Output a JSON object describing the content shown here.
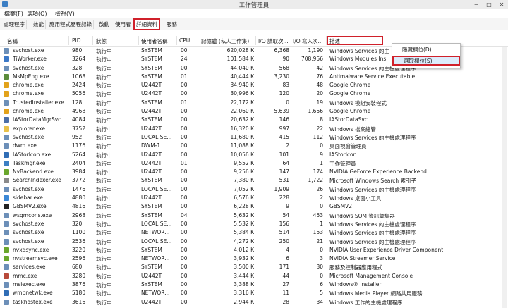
{
  "window": {
    "title": "工作管理員",
    "minimize": "─",
    "maximize": "□",
    "close": "✕"
  },
  "menubar": [
    "檔案(F)",
    "選項(O)",
    "檢視(V)"
  ],
  "tabs": [
    "處理程序",
    "效能",
    "應用程式歷程記錄",
    "啟動",
    "使用者",
    "詳細資料",
    "服務"
  ],
  "active_tab": 5,
  "columns": {
    "name": "名稱",
    "pid": "PID",
    "status": "狀態",
    "user": "使用者名稱",
    "cpu": "CPU",
    "memory": "記憶體 (私人工作集)",
    "io_read": "I/O 讀取次...",
    "io_write": "I/O 寫入次...",
    "desc": "描述"
  },
  "context_menu": {
    "items": [
      "隱藏欄位(D)",
      "選取欄位(S)"
    ],
    "selected": 1
  },
  "rows": [
    {
      "name": "svchost.exe",
      "pid": "980",
      "status": "執行中",
      "user": "SYSTEM",
      "cpu": "00",
      "mem": "620,028 K",
      "ior": "6,368",
      "iow": "1,190",
      "desc": "Windows Services 的主",
      "icon": "#6c8fb8"
    },
    {
      "name": "TiWorker.exe",
      "pid": "3264",
      "status": "執行中",
      "user": "SYSTEM",
      "cpu": "24",
      "mem": "101,584 K",
      "ior": "90",
      "iow": "708,956",
      "desc": "Windows Modules Ins",
      "icon": "#3b78c7"
    },
    {
      "name": "svchost.exe",
      "pid": "328",
      "status": "執行中",
      "user": "SYSTEM",
      "cpu": "00",
      "mem": "44,040 K",
      "ior": "568",
      "iow": "42",
      "desc": "Windows Services 的主機處理程序",
      "icon": "#6c8fb8"
    },
    {
      "name": "MsMpEng.exe",
      "pid": "1068",
      "status": "執行中",
      "user": "SYSTEM",
      "cpu": "01",
      "mem": "40,444 K",
      "ior": "3,230",
      "iow": "76",
      "desc": "Antimalware Service Executable",
      "icon": "#5b8c3a"
    },
    {
      "name": "chrome.exe",
      "pid": "2424",
      "status": "執行中",
      "user": "U2442T",
      "cpu": "00",
      "mem": "34,940 K",
      "ior": "83",
      "iow": "48",
      "desc": "Google Chrome",
      "icon": "#e2a21b"
    },
    {
      "name": "chrome.exe",
      "pid": "5056",
      "status": "執行中",
      "user": "U2442T",
      "cpu": "00",
      "mem": "30,996 K",
      "ior": "120",
      "iow": "20",
      "desc": "Google Chrome",
      "icon": "#e2a21b"
    },
    {
      "name": "TrustedInstaller.exe",
      "pid": "128",
      "status": "執行中",
      "user": "SYSTEM",
      "cpu": "01",
      "mem": "22,172 K",
      "ior": "0",
      "iow": "19",
      "desc": "Windows 模組安裝程式",
      "icon": "#6c8fb8"
    },
    {
      "name": "chrome.exe",
      "pid": "4968",
      "status": "執行中",
      "user": "U2442T",
      "cpu": "00",
      "mem": "22,060 K",
      "ior": "5,639",
      "iow": "1,656",
      "desc": "Google Chrome",
      "icon": "#e2a21b"
    },
    {
      "name": "IAStorDataMgrSvc....",
      "pid": "4084",
      "status": "執行中",
      "user": "SYSTEM",
      "cpu": "00",
      "mem": "20,632 K",
      "ior": "146",
      "iow": "8",
      "desc": "IAStorDataSvc",
      "icon": "#4a6ea8"
    },
    {
      "name": "explorer.exe",
      "pid": "3752",
      "status": "執行中",
      "user": "U2442T",
      "cpu": "00",
      "mem": "16,320 K",
      "ior": "997",
      "iow": "22",
      "desc": "Windows 檔案總管",
      "icon": "#e8c14a"
    },
    {
      "name": "svchost.exe",
      "pid": "952",
      "status": "執行中",
      "user": "LOCAL SE...",
      "cpu": "00",
      "mem": "11,680 K",
      "ior": "415",
      "iow": "112",
      "desc": "Windows Services 的主機處理程序",
      "icon": "#6c8fb8"
    },
    {
      "name": "dwm.exe",
      "pid": "1176",
      "status": "執行中",
      "user": "DWM-1",
      "cpu": "00",
      "mem": "11,088 K",
      "ior": "2",
      "iow": "0",
      "desc": "桌面視窗管理員",
      "icon": "#6c8fb8"
    },
    {
      "name": "IAStorIcon.exe",
      "pid": "5264",
      "status": "執行中",
      "user": "U2442T",
      "cpu": "00",
      "mem": "10,056 K",
      "ior": "101",
      "iow": "9",
      "desc": "IAStorIcon",
      "icon": "#2f6db5"
    },
    {
      "name": "Taskmgr.exe",
      "pid": "2404",
      "status": "執行中",
      "user": "U2442T",
      "cpu": "01",
      "mem": "9,552 K",
      "ior": "64",
      "iow": "1",
      "desc": "工作管理員",
      "icon": "#3c7fc4"
    },
    {
      "name": "NvBackend.exe",
      "pid": "3984",
      "status": "執行中",
      "user": "U2442T",
      "cpu": "00",
      "mem": "9,256 K",
      "ior": "147",
      "iow": "174",
      "desc": "NVIDIA GeForce Experience Backend",
      "icon": "#6aa72c"
    },
    {
      "name": "SearchIndexer.exe",
      "pid": "3772",
      "status": "執行中",
      "user": "SYSTEM",
      "cpu": "00",
      "mem": "7,380 K",
      "ior": "531",
      "iow": "1,722",
      "desc": "Microsoft Windows Search 索引子",
      "icon": "#8a8a8a"
    },
    {
      "name": "svchost.exe",
      "pid": "1476",
      "status": "執行中",
      "user": "LOCAL SE...",
      "cpu": "00",
      "mem": "7,052 K",
      "ior": "1,909",
      "iow": "26",
      "desc": "Windows Services 的主機處理程序",
      "icon": "#6c8fb8"
    },
    {
      "name": "sidebar.exe",
      "pid": "4880",
      "status": "執行中",
      "user": "U2442T",
      "cpu": "00",
      "mem": "6,576 K",
      "ior": "228",
      "iow": "2",
      "desc": "Windows 桌面小工具",
      "icon": "#3a87d6"
    },
    {
      "name": "GBSMV2.exe",
      "pid": "4816",
      "status": "執行中",
      "user": "SYSTEM",
      "cpu": "00",
      "mem": "6,228 K",
      "ior": "9",
      "iow": "0",
      "desc": "GBSMV2",
      "icon": "#222222"
    },
    {
      "name": "wsqmcons.exe",
      "pid": "2968",
      "status": "執行中",
      "user": "SYSTEM",
      "cpu": "04",
      "mem": "5,632 K",
      "ior": "54",
      "iow": "453",
      "desc": "Windows SQM 資訊彙集器",
      "icon": "#6c8fb8"
    },
    {
      "name": "svchost.exe",
      "pid": "320",
      "status": "執行中",
      "user": "LOCAL SE...",
      "cpu": "00",
      "mem": "5,532 K",
      "ior": "156",
      "iow": "1",
      "desc": "Windows Services 的主機處理程序",
      "icon": "#6c8fb8"
    },
    {
      "name": "svchost.exe",
      "pid": "1100",
      "status": "執行中",
      "user": "NETWOR...",
      "cpu": "00",
      "mem": "5,384 K",
      "ior": "514",
      "iow": "153",
      "desc": "Windows Services 的主機處理程序",
      "icon": "#6c8fb8"
    },
    {
      "name": "svchost.exe",
      "pid": "2536",
      "status": "執行中",
      "user": "LOCAL SE...",
      "cpu": "00",
      "mem": "4,272 K",
      "ior": "250",
      "iow": "21",
      "desc": "Windows Services 的主機處理程序",
      "icon": "#6c8fb8"
    },
    {
      "name": "nvxdsync.exe",
      "pid": "3220",
      "status": "執行中",
      "user": "SYSTEM",
      "cpu": "00",
      "mem": "4,012 K",
      "ior": "4",
      "iow": "0",
      "desc": "NVIDIA User Experience Driver Component",
      "icon": "#6aa72c"
    },
    {
      "name": "nvstreamsvc.exe",
      "pid": "2596",
      "status": "執行中",
      "user": "NETWOR...",
      "cpu": "00",
      "mem": "3,932 K",
      "ior": "6",
      "iow": "3",
      "desc": "NVIDIA Streamer Service",
      "icon": "#6aa72c"
    },
    {
      "name": "services.exe",
      "pid": "680",
      "status": "執行中",
      "user": "SYSTEM",
      "cpu": "00",
      "mem": "3,500 K",
      "ior": "171",
      "iow": "30",
      "desc": "服務及控制器應用程式",
      "icon": "#6c8fb8"
    },
    {
      "name": "mmc.exe",
      "pid": "3280",
      "status": "執行中",
      "user": "U2442T",
      "cpu": "00",
      "mem": "3,444 K",
      "ior": "44",
      "iow": "0",
      "desc": "Microsoft Management Console",
      "icon": "#b84a3a"
    },
    {
      "name": "msiexec.exe",
      "pid": "3876",
      "status": "執行中",
      "user": "SYSTEM",
      "cpu": "00",
      "mem": "3,388 K",
      "ior": "27",
      "iow": "6",
      "desc": "Windows® installer",
      "icon": "#6c8fb8"
    },
    {
      "name": "wmpnetwk.exe",
      "pid": "5180",
      "status": "執行中",
      "user": "NETWOR...",
      "cpu": "00",
      "mem": "3,316 K",
      "ior": "11",
      "iow": "5",
      "desc": "Windows Media Player 網路共用服務",
      "icon": "#2f6db5"
    },
    {
      "name": "taskhostex.exe",
      "pid": "3616",
      "status": "執行中",
      "user": "U2442T",
      "cpu": "00",
      "mem": "2,944 K",
      "ior": "28",
      "iow": "34",
      "desc": "Windows 工作的主機處理程序",
      "icon": "#6c8fb8"
    }
  ]
}
